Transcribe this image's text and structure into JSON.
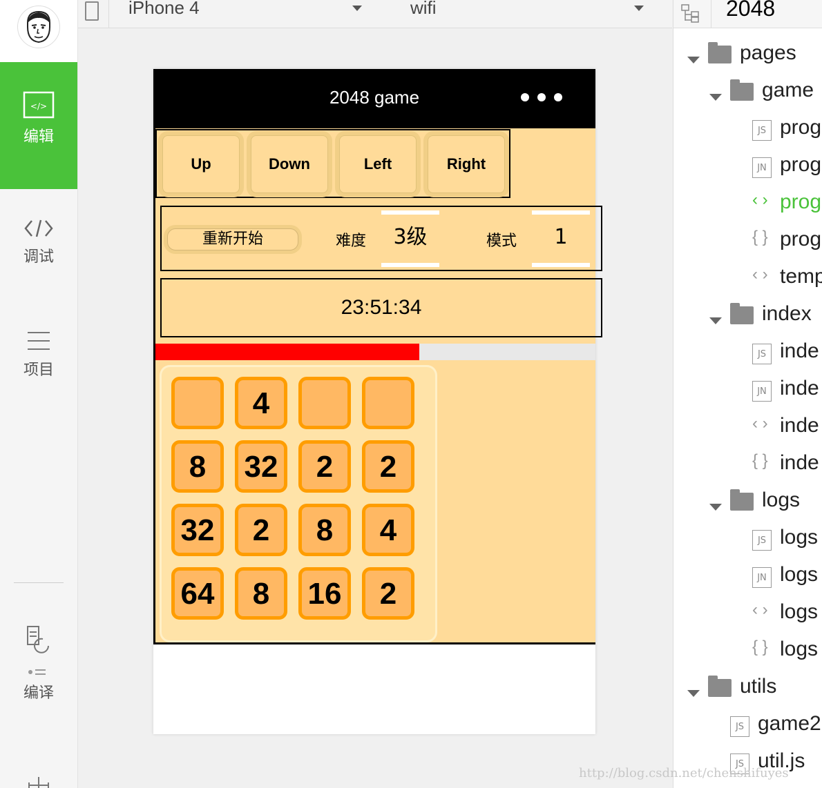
{
  "sidebar": {
    "items": [
      {
        "label": "编辑",
        "icon": "code-window-icon"
      },
      {
        "label": "调试",
        "icon": "code-brackets-icon"
      },
      {
        "label": "项目",
        "icon": "list-icon"
      },
      {
        "label": "编译",
        "icon": "compile-icon"
      }
    ]
  },
  "toolbar": {
    "device": "iPhone 4",
    "network": "wifi"
  },
  "phone": {
    "nav_title": "2048 game",
    "controls": {
      "up": "Up",
      "down": "Down",
      "left": "Left",
      "right": "Right"
    },
    "options": {
      "restart": "重新开始",
      "difficulty_label": "难度",
      "difficulty_value": "3级",
      "mode_label": "模式",
      "mode_value": "1"
    },
    "clock": "23:51:34",
    "progress_fraction": 0.6,
    "board": [
      [
        "",
        "4",
        "",
        ""
      ],
      [
        "8",
        "32",
        "2",
        "2"
      ],
      [
        "32",
        "2",
        "8",
        "4"
      ],
      [
        "64",
        "8",
        "16",
        "2"
      ]
    ]
  },
  "filetree": {
    "project": "2048",
    "rows": [
      {
        "type": "folder",
        "name": "pages",
        "depth": 0
      },
      {
        "type": "folder",
        "name": "game",
        "depth": 1
      },
      {
        "type": "js",
        "name": "prog",
        "depth": 2
      },
      {
        "type": "json",
        "name": "prog",
        "depth": 2
      },
      {
        "type": "wxml",
        "name": "prog",
        "depth": 2,
        "active": true
      },
      {
        "type": "wxss",
        "name": "prog",
        "depth": 2
      },
      {
        "type": "wxml",
        "name": "temp",
        "depth": 2
      },
      {
        "type": "folder",
        "name": "index",
        "depth": 1
      },
      {
        "type": "js",
        "name": "inde",
        "depth": 2
      },
      {
        "type": "json",
        "name": "inde",
        "depth": 2
      },
      {
        "type": "wxml",
        "name": "inde",
        "depth": 2
      },
      {
        "type": "wxss",
        "name": "inde",
        "depth": 2
      },
      {
        "type": "folder",
        "name": "logs",
        "depth": 1
      },
      {
        "type": "js",
        "name": "logs",
        "depth": 2
      },
      {
        "type": "json",
        "name": "logs",
        "depth": 2
      },
      {
        "type": "wxml",
        "name": "logs",
        "depth": 2
      },
      {
        "type": "wxss",
        "name": "logs",
        "depth": 2
      },
      {
        "type": "folder",
        "name": "utils",
        "depth": 0
      },
      {
        "type": "js",
        "name": "game2",
        "depth": 1
      },
      {
        "type": "js",
        "name": "util.js",
        "depth": 1
      }
    ]
  },
  "badges": {
    "js": "JS",
    "json": "JN"
  },
  "watermark": "http://blog.csdn.net/chenshifuyes",
  "colors": {
    "accent": "#4ac23a",
    "tile_bg": "#ffb863",
    "tile_border": "#ff9d00",
    "game_bg": "#ffdb99",
    "progress": "#ff0000"
  }
}
